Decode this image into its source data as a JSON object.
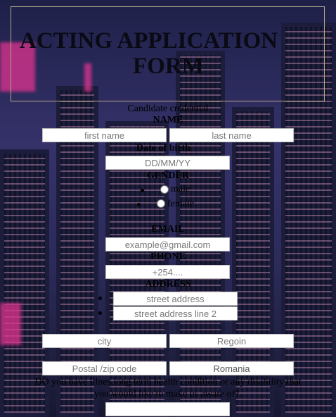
{
  "form": {
    "title_line1": "ACTING APPLICATION",
    "title_line2": "FORM",
    "section_heading": "Candidate credential",
    "name_label": "NAME",
    "first_name": {
      "placeholder": "first name",
      "value": ""
    },
    "last_name": {
      "placeholder": "last name",
      "value": ""
    },
    "dob_label": "Date of birth",
    "dob": {
      "placeholder": "DD/MM/YY",
      "value": ""
    },
    "gender_label": "GENDER",
    "gender_options": [
      "male",
      "female"
    ],
    "email_label": "EMAIL",
    "email": {
      "placeholder": "example@gmail.com",
      "value": ""
    },
    "phone_label": "PHONE",
    "phone": {
      "placeholder": "+254....",
      "value": ""
    },
    "address_label": "ADDRESS",
    "street": {
      "placeholder": "street address",
      "value": ""
    },
    "street2": {
      "placeholder": "street address line 2",
      "value": ""
    },
    "city": {
      "placeholder": "city",
      "value": ""
    },
    "region": {
      "placeholder": "Regoin",
      "value": ""
    },
    "postal": {
      "placeholder": "Postal /zip code",
      "value": ""
    },
    "country": {
      "value": "Romania"
    },
    "health_question_line1": "DO you have illnes,long term health condition or any disability that",
    "health_question_line2": "you would like to make us aware of?.",
    "health_answer": {
      "value": ""
    }
  }
}
